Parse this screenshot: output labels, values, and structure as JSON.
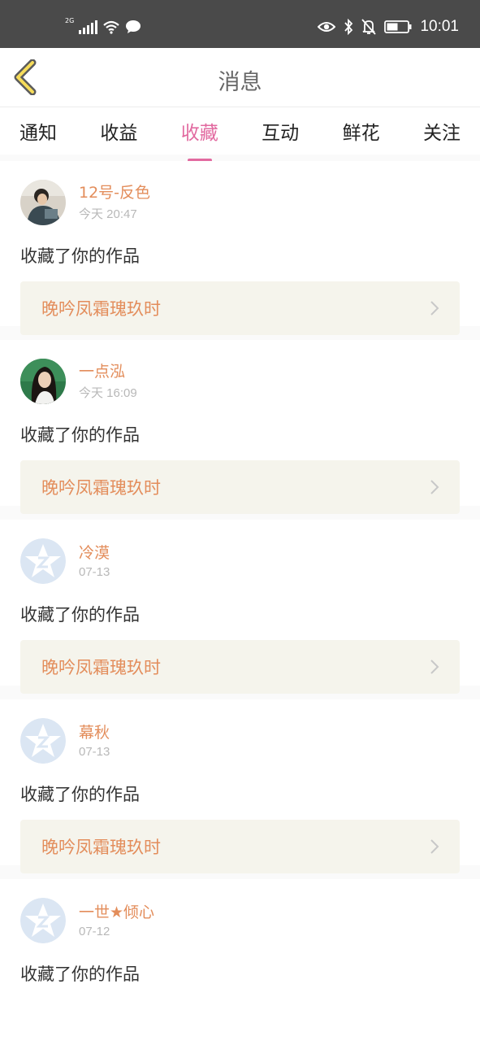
{
  "status": {
    "network": "2G",
    "time": "10:01"
  },
  "header": {
    "title": "消息"
  },
  "tabs": [
    {
      "label": "通知"
    },
    {
      "label": "收益"
    },
    {
      "label": "收藏",
      "active": true
    },
    {
      "label": "互动"
    },
    {
      "label": "鲜花"
    },
    {
      "label": "关注"
    }
  ],
  "messages": [
    {
      "name": "12号-反色",
      "time": "今天 20:47",
      "action": "收藏了你的作品",
      "work": "晚吟凤霜瑰玖时",
      "avatar": "photo-boy-avatar"
    },
    {
      "name": "一点泓",
      "time": "今天 16:09",
      "action": "收藏了你的作品",
      "work": "晚吟凤霜瑰玖时",
      "avatar": "photo-girl-avatar"
    },
    {
      "name": "冷漠",
      "time": "07-13",
      "action": "收藏了你的作品",
      "work": "晚吟凤霜瑰玖时",
      "avatar": "default-star-avatar"
    },
    {
      "name": "幕秋",
      "time": "07-13",
      "action": "收藏了你的作品",
      "work": "晚吟凤霜瑰玖时",
      "avatar": "default-star-avatar"
    },
    {
      "name": "一世★倾心",
      "time": "07-12",
      "action": "收藏了你的作品",
      "work": "",
      "avatar": "default-star-avatar"
    }
  ],
  "colors": {
    "accent": "#e26aa0",
    "name": "#e38d5b",
    "workBg": "#f5f4ec"
  }
}
